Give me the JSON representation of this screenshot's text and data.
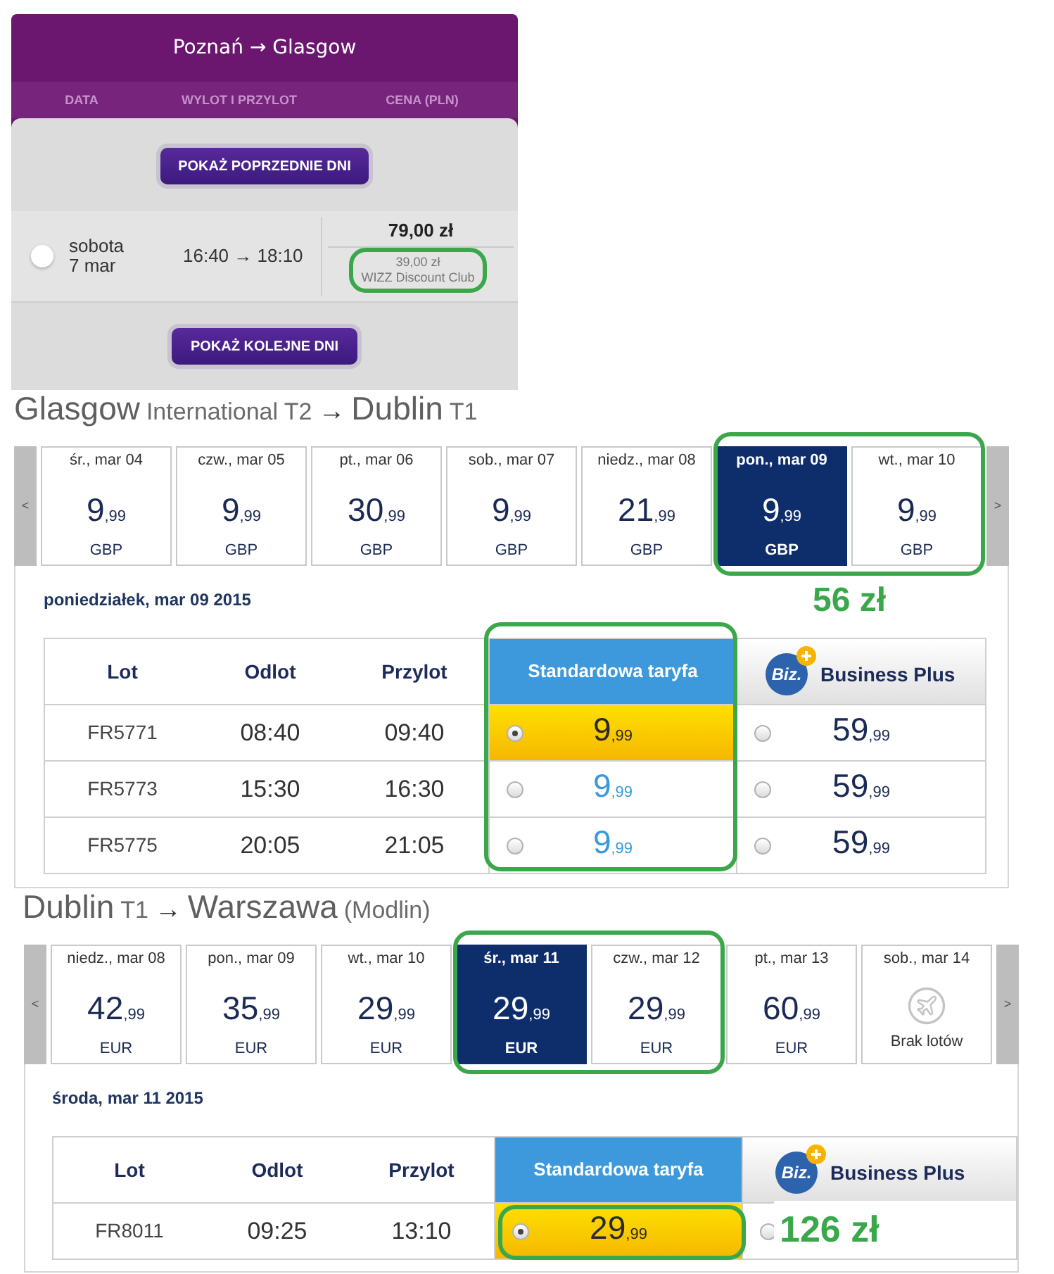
{
  "booking_panel": {
    "title": "Poznań → Glasgow",
    "columns": [
      "DATA",
      "WYLOT I PRZYLOT",
      "CENA (PLN)"
    ],
    "previous_button": "POKAŻ POPRZEDNIE DNI",
    "flight": {
      "day": "sobota",
      "date": "7 mar",
      "times": "16:40 → 18:10",
      "price": "79,00 zł",
      "club_price": "39,00 zł",
      "club_label": "WIZZ Discount Club",
      "selected": false,
      "club_highlighted": true
    },
    "next_button": "POKAŻ KOLEJNE DNI"
  },
  "legs": [
    {
      "title": [
        {
          "text": "Glasgow",
          "kind": "city"
        },
        {
          "text": "International T2",
          "kind": "detail"
        },
        {
          "text": "→",
          "kind": "arrow"
        },
        {
          "text": "Dublin",
          "kind": "city"
        },
        {
          "text": "T1",
          "kind": "detail"
        }
      ],
      "prev": "<",
      "next": ">",
      "dates": [
        {
          "label": "śr., mar 04",
          "kind": "fare",
          "amount": "9",
          "decimals": ",99",
          "currency": "GBP",
          "selected": false,
          "highlighted": false
        },
        {
          "label": "czw., mar 05",
          "kind": "fare",
          "amount": "9",
          "decimals": ",99",
          "currency": "GBP",
          "selected": false,
          "highlighted": false
        },
        {
          "label": "pt., mar 06",
          "kind": "fare",
          "amount": "30",
          "decimals": ",99",
          "currency": "GBP",
          "selected": false,
          "highlighted": false
        },
        {
          "label": "sob., mar 07",
          "kind": "fare",
          "amount": "9",
          "decimals": ",99",
          "currency": "GBP",
          "selected": false,
          "highlighted": false
        },
        {
          "label": "niedz., mar 08",
          "kind": "fare",
          "amount": "21",
          "decimals": ",99",
          "currency": "GBP",
          "selected": false,
          "highlighted": false
        },
        {
          "label": "pon., mar 09",
          "kind": "fare",
          "amount": "9",
          "decimals": ",99",
          "currency": "GBP",
          "selected": true,
          "highlighted": true
        },
        {
          "label": "wt., mar 10",
          "kind": "fare",
          "amount": "9",
          "decimals": ",99",
          "currency": "GBP",
          "selected": false,
          "highlighted": true
        }
      ],
      "annotation": "56 zł",
      "day_heading": "poniedziałek, mar 09 2015",
      "table": {
        "columns": [
          "Lot",
          "Odlot",
          "Przylot",
          "Standardowa taryfa",
          "Business Plus"
        ],
        "badge": "Biz.",
        "standard_column_highlighted": true,
        "rows": [
          {
            "flight": "FR5771",
            "departure": "08:40",
            "arrival": "09:40",
            "standard": {
              "amount": "9",
              "decimals": ",99",
              "selected": true,
              "highlighted": false
            },
            "business": {
              "amount": "59",
              "decimals": ",99",
              "selected": false
            }
          },
          {
            "flight": "FR5773",
            "departure": "15:30",
            "arrival": "16:30",
            "standard": {
              "amount": "9",
              "decimals": ",99",
              "selected": false,
              "highlighted": false
            },
            "business": {
              "amount": "59",
              "decimals": ",99",
              "selected": false
            }
          },
          {
            "flight": "FR5775",
            "departure": "20:05",
            "arrival": "21:05",
            "standard": {
              "amount": "9",
              "decimals": ",99",
              "selected": false,
              "highlighted": false
            },
            "business": {
              "amount": "59",
              "decimals": ",99",
              "selected": false
            }
          }
        ]
      }
    },
    {
      "title": [
        {
          "text": "Dublin",
          "kind": "city"
        },
        {
          "text": "T1",
          "kind": "detail"
        },
        {
          "text": "→",
          "kind": "arrow"
        },
        {
          "text": "Warszawa",
          "kind": "city"
        },
        {
          "text": "(Modlin)",
          "kind": "detail"
        }
      ],
      "prev": "<",
      "next": ">",
      "dates": [
        {
          "label": "niedz., mar 08",
          "kind": "fare",
          "amount": "42",
          "decimals": ",99",
          "currency": "EUR",
          "selected": false,
          "highlighted": false
        },
        {
          "label": "pon., mar 09",
          "kind": "fare",
          "amount": "35",
          "decimals": ",99",
          "currency": "EUR",
          "selected": false,
          "highlighted": false
        },
        {
          "label": "wt., mar 10",
          "kind": "fare",
          "amount": "29",
          "decimals": ",99",
          "currency": "EUR",
          "selected": false,
          "highlighted": false
        },
        {
          "label": "śr., mar 11",
          "kind": "fare",
          "amount": "29",
          "decimals": ",99",
          "currency": "EUR",
          "selected": true,
          "highlighted": true
        },
        {
          "label": "czw., mar 12",
          "kind": "fare",
          "amount": "29",
          "decimals": ",99",
          "currency": "EUR",
          "selected": false,
          "highlighted": true
        },
        {
          "label": "pt., mar 13",
          "kind": "fare",
          "amount": "60",
          "decimals": ",99",
          "currency": "EUR",
          "selected": false,
          "highlighted": false
        },
        {
          "label": "sob., mar 14",
          "kind": "no_flights",
          "note": "Brak lotów",
          "selected": false,
          "highlighted": false
        }
      ],
      "day_heading": "środa, mar 11 2015",
      "table": {
        "columns": [
          "Lot",
          "Odlot",
          "Przylot",
          "Standardowa taryfa",
          "Business Plus"
        ],
        "badge": "Biz.",
        "standard_column_highlighted": false,
        "rows": [
          {
            "flight": "FR8011",
            "departure": "09:25",
            "arrival": "13:10",
            "standard": {
              "amount": "29",
              "decimals": ",99",
              "selected": true,
              "highlighted": true
            },
            "business": {
              "selected": false,
              "annotation": "126 zł"
            }
          }
        ]
      }
    }
  ]
}
